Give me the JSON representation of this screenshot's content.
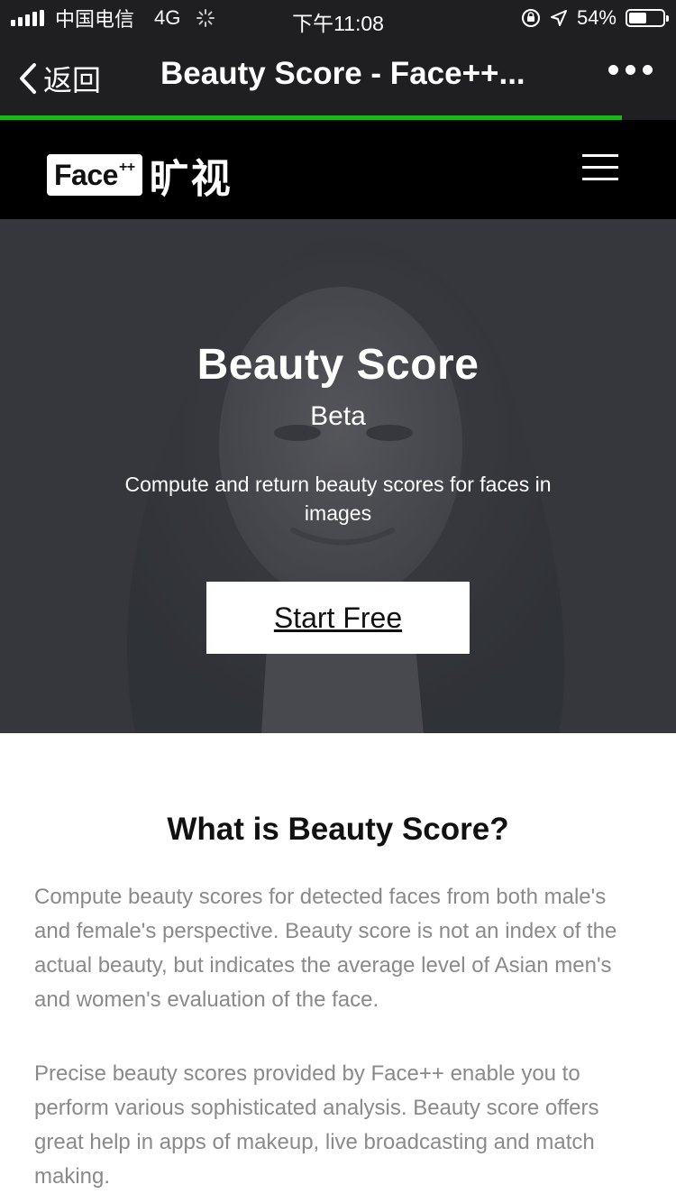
{
  "status_bar": {
    "carrier": "中国电信",
    "network": "4G",
    "time": "下午11:08",
    "battery_percent": "54%",
    "battery_level": 0.54
  },
  "nav": {
    "back_label": "返回",
    "title": "Beauty Score - Face++...",
    "progress": 0.92
  },
  "site_header": {
    "logo_text": "Face",
    "logo_sup": "++",
    "logo_cn": "旷视"
  },
  "hero": {
    "title": "Beauty Score",
    "subtitle": "Beta",
    "description": "Compute and return beauty scores for faces in images",
    "cta_label": "Start Free"
  },
  "content": {
    "heading": "What is Beauty Score?",
    "paragraph1": "Compute beauty scores for detected faces from both male's and female's perspective. Beauty score is not an index of the actual beauty, but indicates the average level of Asian men's and women's evaluation of the face.",
    "paragraph2": "Precise beauty scores provided by Face++ enable you to perform various sophisticated analysis. Beauty score offers great help in apps of makeup, live broadcasting and match making."
  },
  "colors": {
    "status_bg": "#1f1f21",
    "progress": "#1bb51e",
    "site_header_bg": "#000000",
    "body_text": "#8a8a8a"
  }
}
